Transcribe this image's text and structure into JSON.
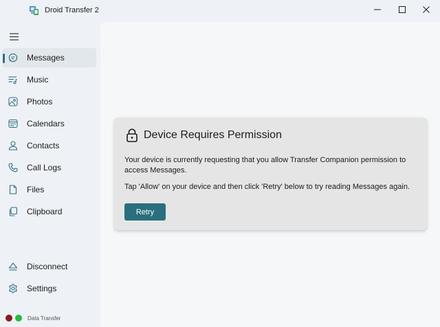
{
  "app": {
    "title": "Droid Transfer 2",
    "icon": "droid-transfer-app-icon"
  },
  "window_controls": {
    "minimize": "minimize-icon",
    "maximize": "maximize-icon",
    "close": "close-icon"
  },
  "sidebar": {
    "menu_icon": "hamburger-menu-icon",
    "items": [
      {
        "label": "Messages",
        "icon": "chat-bubble-icon",
        "selected": true
      },
      {
        "label": "Music",
        "icon": "music-list-icon",
        "selected": false
      },
      {
        "label": "Photos",
        "icon": "photo-icon",
        "selected": false
      },
      {
        "label": "Calendars",
        "icon": "calendar-icon",
        "selected": false
      },
      {
        "label": "Contacts",
        "icon": "person-icon",
        "selected": false
      },
      {
        "label": "Call Logs",
        "icon": "phone-icon",
        "selected": false
      },
      {
        "label": "Files",
        "icon": "file-icon",
        "selected": false
      },
      {
        "label": "Clipboard",
        "icon": "clipboard-icon",
        "selected": false
      }
    ],
    "bottom_items": [
      {
        "label": "Disconnect",
        "icon": "eject-icon"
      },
      {
        "label": "Settings",
        "icon": "gear-icon"
      }
    ],
    "status": {
      "label": "Data Transfer",
      "dot_colors": [
        "#8b1a1a",
        "#1fbf3a"
      ]
    }
  },
  "permission_card": {
    "title": "Device Requires Permission",
    "icon": "lock-icon",
    "message": "Your device is currently requesting that you allow Transfer Companion permission to access Messages.",
    "instruction": "Tap 'Allow' on your device and then click 'Retry' below to try reading Messages again.",
    "retry_label": "Retry"
  },
  "colors": {
    "accent": "#2a6f7e",
    "card_background": "#e5e5e5",
    "sidebar_background": "#eef2f6"
  }
}
